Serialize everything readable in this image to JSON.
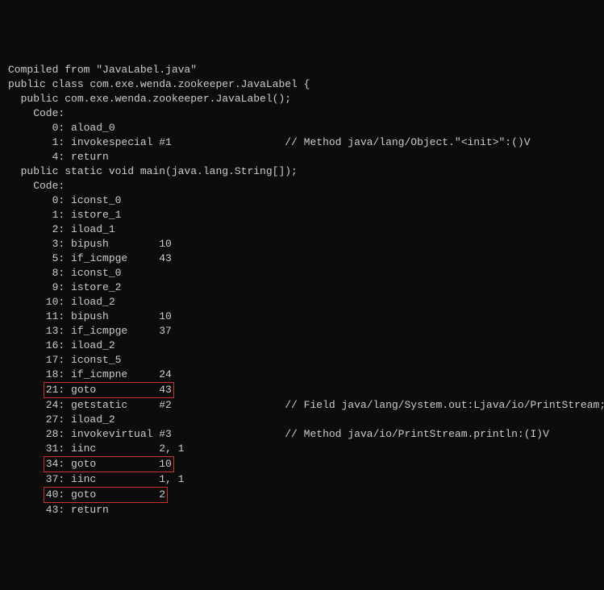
{
  "header": {
    "compiled_from": "Compiled from \"JavaLabel.java\"",
    "class_decl": "public class com.exe.wenda.zookeeper.JavaLabel {",
    "constructor_decl": "  public com.exe.wenda.zookeeper.JavaLabel();",
    "code_label": "    Code:"
  },
  "constructor_code": [
    "       0: aload_0",
    "       1: invokespecial #1                  // Method java/lang/Object.\"<init>\":()V",
    "       4: return"
  ],
  "main_method": {
    "decl": "  public static void main(java.lang.String[]);",
    "code_label": "    Code:"
  },
  "main_code": [
    {
      "text": "       0: iconst_0",
      "highlight": false
    },
    {
      "text": "       1: istore_1",
      "highlight": false
    },
    {
      "text": "       2: iload_1",
      "highlight": false
    },
    {
      "text": "       3: bipush        10",
      "highlight": false
    },
    {
      "text": "       5: if_icmpge     43",
      "highlight": false
    },
    {
      "text": "       8: iconst_0",
      "highlight": false
    },
    {
      "text": "       9: istore_2",
      "highlight": false
    },
    {
      "text": "      10: iload_2",
      "highlight": false
    },
    {
      "text": "      11: bipush        10",
      "highlight": false
    },
    {
      "text": "      13: if_icmpge     37",
      "highlight": false
    },
    {
      "text": "      16: iload_2",
      "highlight": false
    },
    {
      "text": "      17: iconst_5",
      "highlight": false
    },
    {
      "text": "      18: if_icmpne     24",
      "highlight": false
    },
    {
      "text": "      21: goto          43",
      "highlight": true
    },
    {
      "text": "      24: getstatic     #2                  // Field java/lang/System.out:Ljava/io/PrintStream;",
      "highlight": false
    },
    {
      "text": "      27: iload_2",
      "highlight": false
    },
    {
      "text": "      28: invokevirtual #3                  // Method java/io/PrintStream.println:(I)V",
      "highlight": false
    },
    {
      "text": "      31: iinc          2, 1",
      "highlight": false
    },
    {
      "text": "      34: goto          10",
      "highlight": true
    },
    {
      "text": "      37: iinc          1, 1",
      "highlight": false
    },
    {
      "text": "      40: goto          2",
      "highlight": true
    },
    {
      "text": "      43: return",
      "highlight": false
    }
  ]
}
